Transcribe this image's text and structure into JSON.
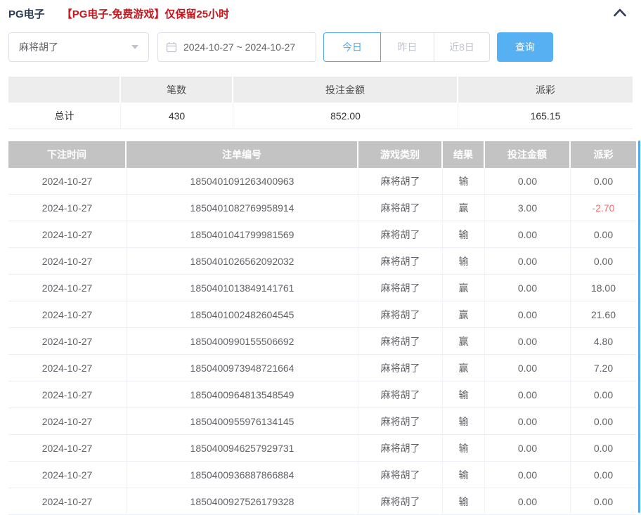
{
  "header": {
    "title": "PG电子",
    "notice": "【PG电子-免费游戏】仅保留25小时"
  },
  "filters": {
    "game_select": {
      "value": "麻将胡了"
    },
    "date_range": {
      "value": "2024-10-27 ~ 2024-10-27"
    },
    "quick_buttons": [
      {
        "label": "今日",
        "active": true
      },
      {
        "label": "昨日",
        "active": false
      },
      {
        "label": "近8日",
        "active": false
      }
    ],
    "search_label": "查询"
  },
  "summary": {
    "columns": [
      "",
      "笔数",
      "投注金额",
      "派彩"
    ],
    "row_label": "总计",
    "count": "430",
    "bet_amount": "852.00",
    "payout": "165.15"
  },
  "table": {
    "columns": [
      "下注时间",
      "注单编号",
      "游戏类别",
      "结果",
      "投注金额",
      "派彩"
    ],
    "rows": [
      {
        "time": "2024-10-27",
        "bet_no": "1850401091263400963",
        "game": "麻将胡了",
        "result": "输",
        "bet": "0.00",
        "payout": "0.00",
        "negative": false
      },
      {
        "time": "2024-10-27",
        "bet_no": "1850401082769958914",
        "game": "麻将胡了",
        "result": "赢",
        "bet": "3.00",
        "payout": "-2.70",
        "negative": true
      },
      {
        "time": "2024-10-27",
        "bet_no": "1850401041799981569",
        "game": "麻将胡了",
        "result": "输",
        "bet": "0.00",
        "payout": "0.00",
        "negative": false
      },
      {
        "time": "2024-10-27",
        "bet_no": "1850401026562092032",
        "game": "麻将胡了",
        "result": "输",
        "bet": "0.00",
        "payout": "0.00",
        "negative": false
      },
      {
        "time": "2024-10-27",
        "bet_no": "1850401013849141761",
        "game": "麻将胡了",
        "result": "赢",
        "bet": "0.00",
        "payout": "18.00",
        "negative": false
      },
      {
        "time": "2024-10-27",
        "bet_no": "1850401002482604545",
        "game": "麻将胡了",
        "result": "赢",
        "bet": "0.00",
        "payout": "21.60",
        "negative": false
      },
      {
        "time": "2024-10-27",
        "bet_no": "1850400990155506692",
        "game": "麻将胡了",
        "result": "赢",
        "bet": "0.00",
        "payout": "4.80",
        "negative": false
      },
      {
        "time": "2024-10-27",
        "bet_no": "1850400973948721664",
        "game": "麻将胡了",
        "result": "赢",
        "bet": "0.00",
        "payout": "7.20",
        "negative": false
      },
      {
        "time": "2024-10-27",
        "bet_no": "1850400964813548549",
        "game": "麻将胡了",
        "result": "输",
        "bet": "0.00",
        "payout": "0.00",
        "negative": false
      },
      {
        "time": "2024-10-27",
        "bet_no": "1850400955976134145",
        "game": "麻将胡了",
        "result": "输",
        "bet": "0.00",
        "payout": "0.00",
        "negative": false
      },
      {
        "time": "2024-10-27",
        "bet_no": "1850400946257929731",
        "game": "麻将胡了",
        "result": "输",
        "bet": "0.00",
        "payout": "0.00",
        "negative": false
      },
      {
        "time": "2024-10-27",
        "bet_no": "1850400936887866884",
        "game": "麻将胡了",
        "result": "输",
        "bet": "0.00",
        "payout": "0.00",
        "negative": false
      },
      {
        "time": "2024-10-27",
        "bet_no": "1850400927526179328",
        "game": "麻将胡了",
        "result": "输",
        "bet": "0.00",
        "payout": "0.00",
        "negative": false
      }
    ]
  },
  "colors": {
    "accent_blue": "#53a8f1",
    "button_blue": "#56b0f2",
    "notice_red": "#c8161d",
    "danger_red": "#f56c6c",
    "table_header_bg": "#c3c3c3"
  }
}
